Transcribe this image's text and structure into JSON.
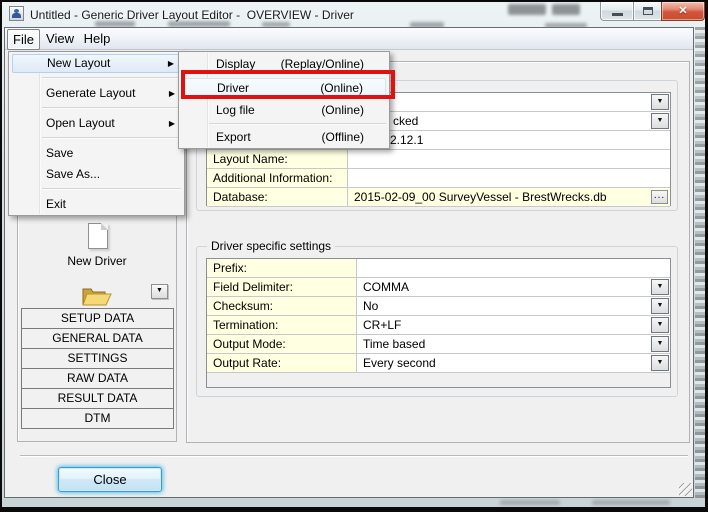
{
  "titlebar": {
    "title": "Untitled - Generic Driver Layout Editor -  OVERVIEW - Driver"
  },
  "menubar": {
    "file": "File",
    "view": "View",
    "help": "Help"
  },
  "file_menu": {
    "items": [
      "New Layout",
      "Generate Layout",
      "Open Layout",
      "Save",
      "Save As...",
      "Exit"
    ]
  },
  "new_layout_submenu": {
    "items": [
      {
        "label": "Display",
        "mode": "(Replay/Online)"
      },
      {
        "label": "Driver",
        "mode": "(Online)"
      },
      {
        "label": "Log file",
        "mode": "(Online)"
      },
      {
        "label": "Export",
        "mode": "(Offline)"
      }
    ]
  },
  "sidebar": {
    "new_driver_label": "New Driver",
    "nav_buttons": [
      "SETUP DATA",
      "GENERAL DATA",
      "SETTINGS",
      "RAW DATA",
      "RESULT DATA",
      "DTM"
    ]
  },
  "overview_panel": {
    "rows": [
      {
        "label": "",
        "value": ""
      },
      {
        "label": "",
        "value": "cked"
      },
      {
        "label": "",
        "value": "2.12.1"
      },
      {
        "label": "Layout Name:",
        "value": ""
      },
      {
        "label": "Additional Information:",
        "value": ""
      },
      {
        "label": "Database:",
        "value": "2015-02-09_00 SurveyVessel - BrestWrecks.db"
      }
    ],
    "browse_label": "..."
  },
  "driver_settings": {
    "title": "Driver specific settings",
    "rows": [
      {
        "label": "Prefix:",
        "value": ""
      },
      {
        "label": "Field Delimiter:",
        "value": "COMMA"
      },
      {
        "label": "Checksum:",
        "value": "No"
      },
      {
        "label": "Termination:",
        "value": "CR+LF"
      },
      {
        "label": "Output Mode:",
        "value": "Time based"
      },
      {
        "label": "Output Rate:",
        "value": "Every second"
      }
    ]
  },
  "footer": {
    "close_label": "Close"
  },
  "glyphs": {
    "dropdown": "▼",
    "submenu_arrow": "▶",
    "close": "✕"
  },
  "colors": {
    "annotation": "#e01111",
    "label_bg": "#ffffe1"
  }
}
